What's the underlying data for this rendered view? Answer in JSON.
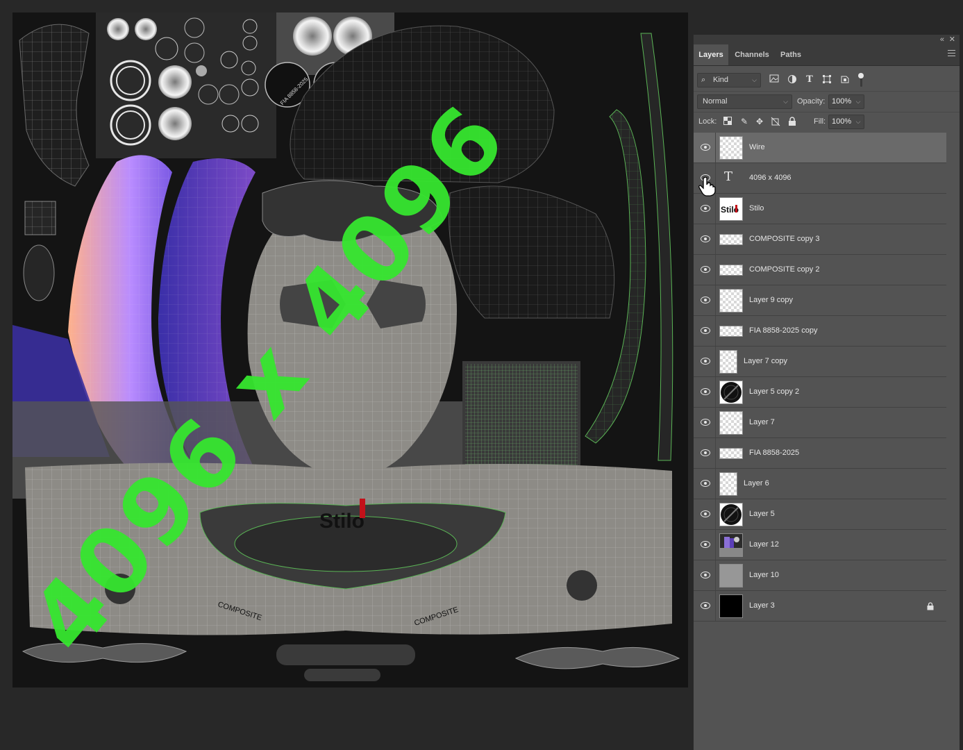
{
  "canvas": {
    "overlay_text": "4096 x 4096",
    "overlay_color": "#36e62f",
    "logo_text": "Stilo",
    "composite_text": "COMPOSITE",
    "fia_text": "FIA 8858-2025"
  },
  "panel": {
    "tabs": [
      {
        "label": "Layers",
        "active": true
      },
      {
        "label": "Channels",
        "active": false
      },
      {
        "label": "Paths",
        "active": false
      }
    ],
    "filter": {
      "kind_label": "Kind"
    },
    "blend_mode": "Normal",
    "opacity_label": "Opacity:",
    "opacity_value": "100%",
    "lock_label": "Lock:",
    "fill_label": "Fill:",
    "fill_value": "100%"
  },
  "layers": [
    {
      "name": "Wire",
      "thumb": "checker",
      "selected": true
    },
    {
      "name": "4096 x 4096",
      "thumb": "type"
    },
    {
      "name": "Stilo",
      "thumb": "stilo"
    },
    {
      "name": "COMPOSITE copy 3",
      "thumb": "wide"
    },
    {
      "name": "COMPOSITE copy 2",
      "thumb": "wide"
    },
    {
      "name": "Layer 9 copy",
      "thumb": "checker"
    },
    {
      "name": "FIA 8858-2025 copy",
      "thumb": "wide"
    },
    {
      "name": "Layer 7 copy",
      "thumb": "checker-narrow"
    },
    {
      "name": "Layer 5 copy 2",
      "thumb": "disc"
    },
    {
      "name": "Layer 7",
      "thumb": "checker"
    },
    {
      "name": "FIA 8858-2025",
      "thumb": "wide"
    },
    {
      "name": "Layer 6",
      "thumb": "checker-narrow"
    },
    {
      "name": "Layer 5",
      "thumb": "disc"
    },
    {
      "name": "Layer 12",
      "thumb": "texture"
    },
    {
      "name": "Layer 10",
      "thumb": "grey"
    },
    {
      "name": "Layer 3",
      "thumb": "black",
      "locked": true
    }
  ]
}
